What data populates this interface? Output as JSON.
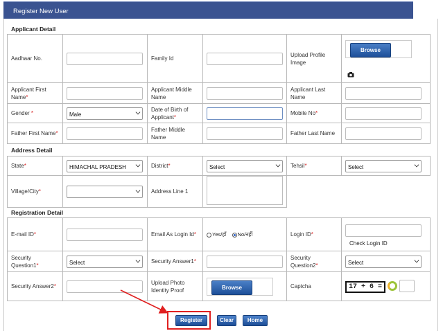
{
  "header": {
    "title": "Register New User"
  },
  "sections": {
    "applicant": "Applicant Detail",
    "address": "Address Detail",
    "registration": "Registration Detail"
  },
  "applicant": {
    "aadhaar_label": "Aadhaar No.",
    "family_id_label": "Family Id",
    "upload_profile_label": "Upload Profile Image",
    "browse_label": "Browse",
    "first_name_label": "Applicant First Name",
    "middle_name_label": "Applicant Middle Name",
    "last_name_label": "Applicant Last Name",
    "gender_label": "Gender",
    "gender_value": "Male",
    "dob_label": "Date of Birth of Applicant",
    "mobile_label": "Mobile No",
    "father_first_label": "Father First Name",
    "father_middle_label": "Father Middle Name",
    "father_last_label": "Father Last Name"
  },
  "address": {
    "state_label": "State",
    "state_value": "HIMACHAL PRADESH",
    "district_label": "District",
    "district_value": "Select",
    "tehsil_label": "Tehsil",
    "tehsil_value": "Select",
    "village_label": "Village/City",
    "village_value": "",
    "address_line1_label": "Address Line 1"
  },
  "registration": {
    "email_label": "E-mail ID",
    "email_as_login_label": "Email As Login Id",
    "yes_label": "Yes/हाँ",
    "no_label": "No/नहीं",
    "login_id_label": "Login ID",
    "check_login_label": "Check Login ID",
    "sec_q1_label": "Security Question1",
    "sec_q1_value": "Select",
    "sec_a1_label": "Security Answer1",
    "sec_q2_label": "Security Question2",
    "sec_q2_value": "Select",
    "sec_a2_label": "Security Answer2",
    "upload_photo_label": "Upload Photo Identity Proof",
    "browse_label": "Browse",
    "captcha_label": "Captcha",
    "captcha_text": "17 + 6 ="
  },
  "buttons": {
    "register": "Register",
    "clear": "Clear",
    "home": "Home"
  },
  "required_mark": "*",
  "colors": {
    "header": "#3a5391",
    "button": "#1c4d96",
    "annotation": "#e02020"
  }
}
